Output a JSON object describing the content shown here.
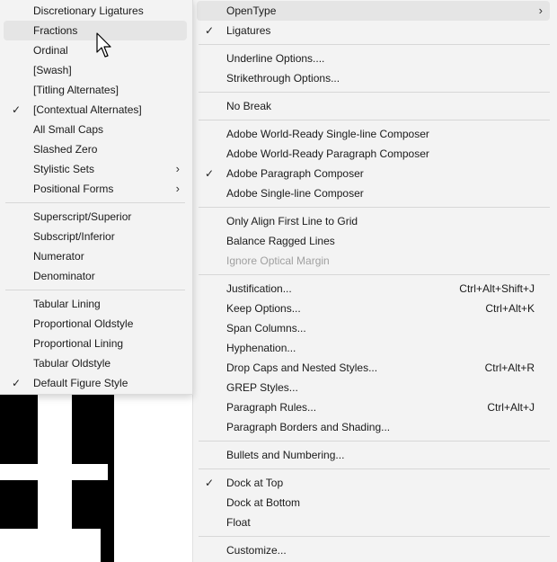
{
  "main_menu": {
    "items": [
      {
        "label": "OpenType",
        "checked": false,
        "submenu": true,
        "shortcut": "",
        "disabled": false,
        "hover": true
      },
      {
        "label": "Ligatures",
        "checked": true,
        "submenu": false,
        "shortcut": "",
        "disabled": false
      },
      {
        "label": "Underline Options....",
        "checked": false,
        "submenu": false,
        "shortcut": "",
        "disabled": false
      },
      {
        "label": "Strikethrough Options...",
        "checked": false,
        "submenu": false,
        "shortcut": "",
        "disabled": false
      },
      {
        "label": "No Break",
        "checked": false,
        "submenu": false,
        "shortcut": "",
        "disabled": false
      },
      {
        "label": "Adobe World-Ready Single-line Composer",
        "checked": false,
        "submenu": false,
        "shortcut": "",
        "disabled": false
      },
      {
        "label": "Adobe World-Ready Paragraph Composer",
        "checked": false,
        "submenu": false,
        "shortcut": "",
        "disabled": false
      },
      {
        "label": "Adobe Paragraph Composer",
        "checked": true,
        "submenu": false,
        "shortcut": "",
        "disabled": false
      },
      {
        "label": "Adobe Single-line Composer",
        "checked": false,
        "submenu": false,
        "shortcut": "",
        "disabled": false
      },
      {
        "label": "Only Align First Line to Grid",
        "checked": false,
        "submenu": false,
        "shortcut": "",
        "disabled": false
      },
      {
        "label": "Balance Ragged Lines",
        "checked": false,
        "submenu": false,
        "shortcut": "",
        "disabled": false
      },
      {
        "label": "Ignore Optical Margin",
        "checked": false,
        "submenu": false,
        "shortcut": "",
        "disabled": true
      },
      {
        "label": "Justification...",
        "checked": false,
        "submenu": false,
        "shortcut": "Ctrl+Alt+Shift+J",
        "disabled": false
      },
      {
        "label": "Keep Options...",
        "checked": false,
        "submenu": false,
        "shortcut": "Ctrl+Alt+K",
        "disabled": false
      },
      {
        "label": "Span Columns...",
        "checked": false,
        "submenu": false,
        "shortcut": "",
        "disabled": false
      },
      {
        "label": "Hyphenation...",
        "checked": false,
        "submenu": false,
        "shortcut": "",
        "disabled": false
      },
      {
        "label": "Drop Caps and Nested Styles...",
        "checked": false,
        "submenu": false,
        "shortcut": "Ctrl+Alt+R",
        "disabled": false
      },
      {
        "label": "GREP Styles...",
        "checked": false,
        "submenu": false,
        "shortcut": "",
        "disabled": false
      },
      {
        "label": "Paragraph Rules...",
        "checked": false,
        "submenu": false,
        "shortcut": "Ctrl+Alt+J",
        "disabled": false
      },
      {
        "label": "Paragraph Borders and Shading...",
        "checked": false,
        "submenu": false,
        "shortcut": "",
        "disabled": false
      },
      {
        "label": "Bullets and Numbering...",
        "checked": false,
        "submenu": false,
        "shortcut": "",
        "disabled": false
      },
      {
        "label": "Dock at Top",
        "checked": true,
        "submenu": false,
        "shortcut": "",
        "disabled": false
      },
      {
        "label": "Dock at Bottom",
        "checked": false,
        "submenu": false,
        "shortcut": "",
        "disabled": false
      },
      {
        "label": "Float",
        "checked": false,
        "submenu": false,
        "shortcut": "",
        "disabled": false
      },
      {
        "label": "Customize...",
        "checked": false,
        "submenu": false,
        "shortcut": "",
        "disabled": false
      }
    ]
  },
  "opentype_submenu": {
    "items": [
      {
        "label": "Discretionary Ligatures",
        "checked": false,
        "submenu": false
      },
      {
        "label": "Fractions",
        "checked": false,
        "submenu": false,
        "hover": true
      },
      {
        "label": "Ordinal",
        "checked": false,
        "submenu": false
      },
      {
        "label": "[Swash]",
        "checked": false,
        "submenu": false
      },
      {
        "label": "[Titling Alternates]",
        "checked": false,
        "submenu": false
      },
      {
        "label": "[Contextual Alternates]",
        "checked": true,
        "submenu": false
      },
      {
        "label": "All Small Caps",
        "checked": false,
        "submenu": false
      },
      {
        "label": "Slashed Zero",
        "checked": false,
        "submenu": false
      },
      {
        "label": "Stylistic Sets",
        "checked": false,
        "submenu": true
      },
      {
        "label": "Positional Forms",
        "checked": false,
        "submenu": true
      },
      {
        "label": "Superscript/Superior",
        "checked": false,
        "submenu": false
      },
      {
        "label": "Subscript/Inferior",
        "checked": false,
        "submenu": false
      },
      {
        "label": "Numerator",
        "checked": false,
        "submenu": false
      },
      {
        "label": "Denominator",
        "checked": false,
        "submenu": false
      },
      {
        "label": "Tabular Lining",
        "checked": false,
        "submenu": false
      },
      {
        "label": "Proportional Oldstyle",
        "checked": false,
        "submenu": false
      },
      {
        "label": "Proportional Lining",
        "checked": false,
        "submenu": false
      },
      {
        "label": "Tabular Oldstyle",
        "checked": false,
        "submenu": false
      },
      {
        "label": "Default Figure Style",
        "checked": true,
        "submenu": false
      }
    ]
  },
  "glyphs": {
    "check": "✓",
    "arrow": "›"
  },
  "colors": {
    "menu_bg": "#f3f3f3",
    "hover_bg": "#e5e5e5",
    "separator": "#d7d7d7",
    "disabled_text": "#a0a0a0"
  }
}
